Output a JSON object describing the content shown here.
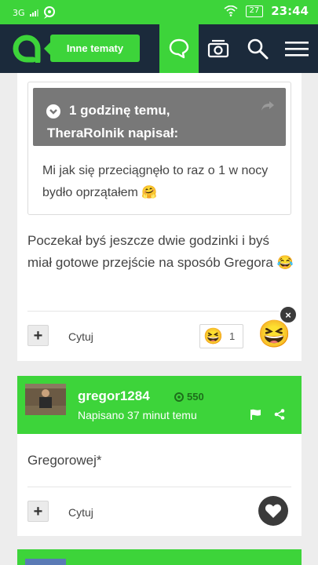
{
  "status_bar": {
    "network": "3G",
    "battery": "27",
    "time": "23:44"
  },
  "header": {
    "topic_button": "Inne tematy",
    "icons": [
      "chat-icon",
      "camera-icon",
      "search-icon",
      "menu-icon"
    ]
  },
  "post1": {
    "quote": {
      "time": "1 godzinę temu,",
      "author": "TheraRolnik napisał:",
      "text": "Mi jak się przeciągnęło to raz o 1 w nocy bydło oprzątałem 🤗"
    },
    "text": "Poczekał byś jeszcze dwie godzinki i byś miał gotowe przejście na sposób Gregora 😂",
    "quote_label": "Cytuj",
    "reaction_emoji": "😆",
    "reaction_count": "1",
    "big_reaction": "😆",
    "close": "×"
  },
  "post2": {
    "username": "gregor1284",
    "reputation": "550",
    "posted": "Napisano 37 minut temu",
    "text": "Gregorowej*",
    "quote_label": "Cytuj"
  },
  "colors": {
    "green": "#3dd43a",
    "navy": "#1b2a3b",
    "grey_quote": "#787878"
  }
}
